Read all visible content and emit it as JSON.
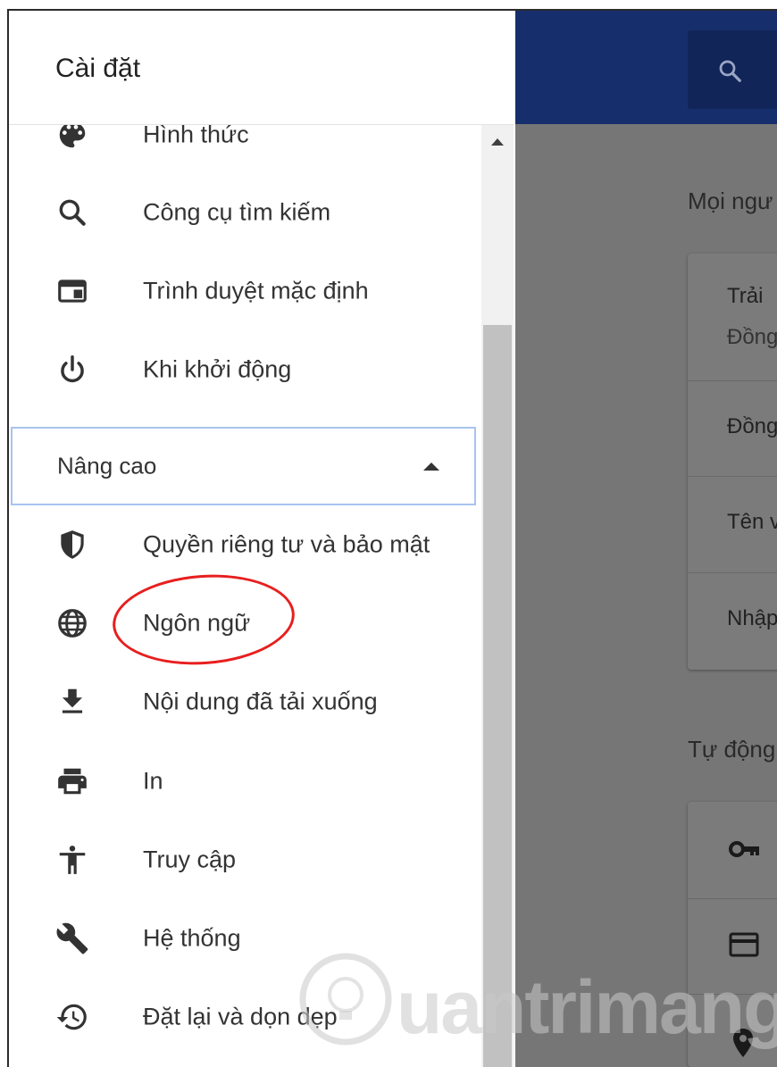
{
  "app": {
    "title": "Cài đặt"
  },
  "sidebar": {
    "items": [
      {
        "label": "Hình thức",
        "icon": "palette-icon"
      },
      {
        "label": "Công cụ tìm kiếm",
        "icon": "search-icon"
      },
      {
        "label": "Trình duyệt mặc định",
        "icon": "browser-window-icon"
      },
      {
        "label": "Khi khởi động",
        "icon": "power-icon"
      }
    ],
    "advanced": {
      "label": "Nâng cao",
      "expanded": true
    },
    "advanced_items": [
      {
        "label": "Quyền riêng tư và bảo mật",
        "icon": "shield-icon"
      },
      {
        "label": "Ngôn ngữ",
        "icon": "globe-icon",
        "highlighted": true
      },
      {
        "label": "Nội dung đã tải xuống",
        "icon": "download-icon"
      },
      {
        "label": "In",
        "icon": "printer-icon"
      },
      {
        "label": "Truy cập",
        "icon": "accessibility-icon"
      },
      {
        "label": "Hệ thống",
        "icon": "wrench-icon"
      },
      {
        "label": "Đặt lại và dọn dẹp",
        "icon": "restore-history-icon"
      }
    ]
  },
  "main": {
    "section1_heading": "Mọi ngư",
    "card1": {
      "row1_title": "Trải",
      "row1_sub": "Đồng",
      "row2": "Đồng",
      "row3": "Tên v",
      "row4": "Nhập"
    },
    "section2_heading": "Tự động",
    "card2_icons": [
      "key-icon",
      "credit-card-icon",
      "location-pin-icon"
    ]
  },
  "watermark": {
    "text": "uantrimang"
  },
  "colors": {
    "topbar": "#172e6d",
    "overlay": "#767676",
    "highlight_ring": "#e81e1e",
    "focus_border": "#a7c4ee"
  }
}
